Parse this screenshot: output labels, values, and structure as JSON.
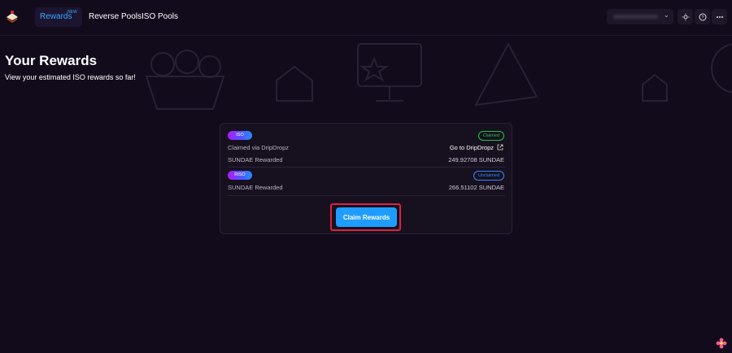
{
  "nav": {
    "rewards": "Rewards",
    "rewards_badge": "NEW",
    "reverse_pools": "Reverse Pools",
    "iso_pools": "ISO Pools"
  },
  "hero": {
    "title": "Your Rewards",
    "subtitle": "View your estimated ISO rewards so far!"
  },
  "rewards": [
    {
      "pill": "ISO",
      "status": "Claimed",
      "claimed_via_label": "Claimed via DripDropz",
      "link_label": "Go to DripDropz",
      "amount_label": "SUNDAE Rewarded",
      "amount_value": "249.92708 SUNDAE"
    },
    {
      "pill": "RISO",
      "status": "Unclaimed",
      "amount_label": "SUNDAE Rewarded",
      "amount_value": "266.51102 SUNDAE"
    }
  ],
  "claim_button": "Claim Rewards",
  "colors": {
    "accent": "#1e9cff",
    "claimed": "#23c24a",
    "unclaimed": "#2f86ff",
    "highlight": "#e0203f"
  }
}
